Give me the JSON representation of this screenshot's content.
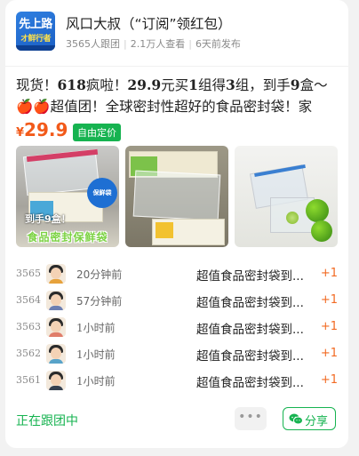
{
  "group": {
    "avatar_text_line1": "先上路",
    "avatar_text_line2": "オ鲜行者",
    "author": "风口大叔（“订阅”领红包）",
    "followers": "3565人跟团",
    "views": "2.1万人查看",
    "posted": "6天前发布"
  },
  "post": {
    "title_parts": [
      "现货！",
      "618",
      "疯啦！",
      "29.9",
      "元买",
      "1",
      "组得",
      "3",
      "组，到手",
      "9",
      "盒～🍎🍎超值团！全球密封性超好的食品密封袋！家庭…"
    ],
    "price_symbol": "¥",
    "price": "29.9",
    "price_tag": "自由定价",
    "images": [
      {
        "overlay": "到手9盒！",
        "caption": "食品密封保鲜袋",
        "sticker": "保鲜袋"
      },
      {
        "overlay": ""
      },
      {
        "overlay": ""
      }
    ]
  },
  "orders": [
    {
      "seq": "3565",
      "time": "20分钟前",
      "product": "超值食品密封袋到...",
      "qty": "+1",
      "shirt": "#e6a23c"
    },
    {
      "seq": "3564",
      "time": "57分钟前",
      "product": "超值食品密封袋到...",
      "qty": "+1",
      "shirt": "#6d7fb2"
    },
    {
      "seq": "3563",
      "time": "1小时前",
      "product": "超值食品密封袋到...",
      "qty": "+1",
      "shirt": "#e07d6a"
    },
    {
      "seq": "3562",
      "time": "1小时前",
      "product": "超值食品密封袋到...",
      "qty": "+1",
      "shirt": "#58a3c9"
    },
    {
      "seq": "3561",
      "time": "1小时前",
      "product": "超值食品密封袋到...",
      "qty": "+1",
      "shirt": "#36404f"
    }
  ],
  "footer": {
    "status": "正在跟团中",
    "more_label": "•••",
    "share_label": "分享"
  },
  "colors": {
    "accent_green": "#16b350",
    "price_orange": "#f25a1a",
    "plus_orange": "#f26a22"
  }
}
